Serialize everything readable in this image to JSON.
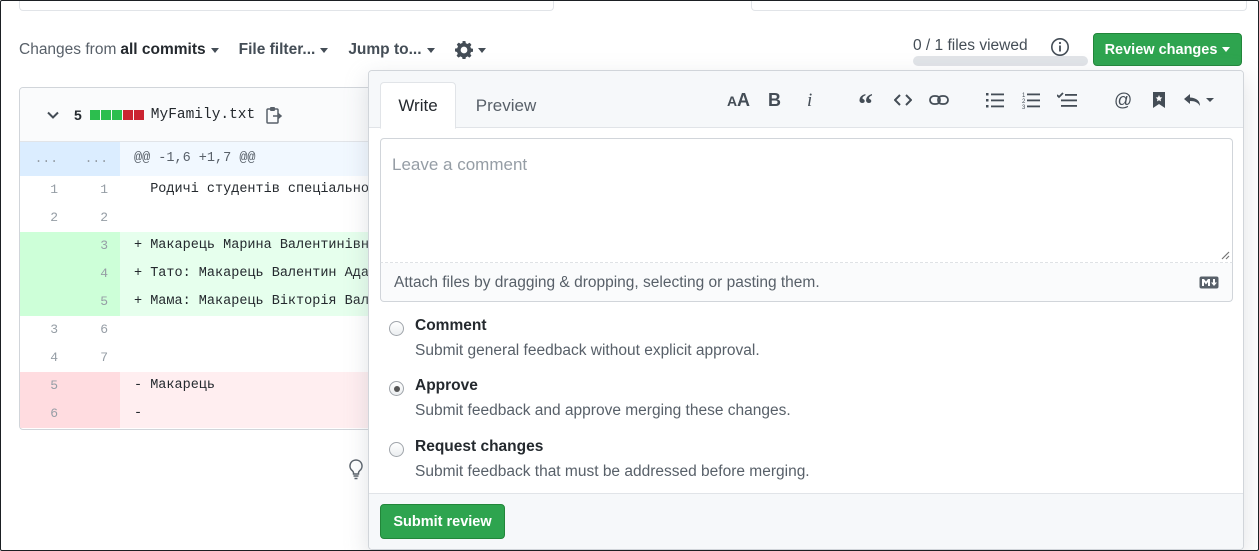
{
  "toolbar": {
    "changes_from_label": "Changes from",
    "changes_from_value": "all commits",
    "file_filter_label": "File filter...",
    "jump_to_label": "Jump to...",
    "files_viewed": "0 / 1 files viewed",
    "files_viewed_progress": 0,
    "review_changes_label": "Review changes"
  },
  "file": {
    "changed_count": "5",
    "diffstat": [
      "#2cbe4e",
      "#2cbe4e",
      "#2cbe4e",
      "#cb2431",
      "#cb2431"
    ],
    "name": "MyFamily.txt",
    "lines": [
      {
        "type": "hunk",
        "old": "...",
        "new": "...",
        "text": "@@ -1,6 +1,7 @@"
      },
      {
        "type": "ctx",
        "old": "1",
        "new": "1",
        "text": "  Родичі студентів спеціально"
      },
      {
        "type": "ctx",
        "old": "2",
        "new": "2",
        "text": ""
      },
      {
        "type": "add",
        "old": "",
        "new": "3",
        "text": "+ Макарець Марина Валентинівн"
      },
      {
        "type": "add",
        "old": "",
        "new": "4",
        "text": "+ Тато: Макарець Валентин Ада"
      },
      {
        "type": "add",
        "old": "",
        "new": "5",
        "text": "+ Мама: Макарець Вікторія Вал"
      },
      {
        "type": "ctx",
        "old": "3",
        "new": "6",
        "text": ""
      },
      {
        "type": "ctx",
        "old": "4",
        "new": "7",
        "text": ""
      },
      {
        "type": "del",
        "old": "5",
        "new": "",
        "text": "- Макарець"
      },
      {
        "type": "del",
        "old": "6",
        "new": "",
        "text": "-"
      }
    ]
  },
  "review": {
    "tab_write": "Write",
    "tab_preview": "Preview",
    "comment_placeholder": "Leave a comment",
    "attach_text": "Attach files by dragging & dropping, selecting or pasting them.",
    "options": [
      {
        "label": "Comment",
        "desc": "Submit general feedback without explicit approval.",
        "selected": false
      },
      {
        "label": "Approve",
        "desc": "Submit feedback and approve merging these changes.",
        "selected": true
      },
      {
        "label": "Request changes",
        "desc": "Submit feedback that must be addressed before merging.",
        "selected": false
      }
    ],
    "submit_label": "Submit review"
  },
  "colors": {
    "primary_green": "#2ea44f",
    "add_bg": "#e6ffed",
    "del_bg": "#ffeef0",
    "hunk_bg": "#f1f8ff"
  }
}
